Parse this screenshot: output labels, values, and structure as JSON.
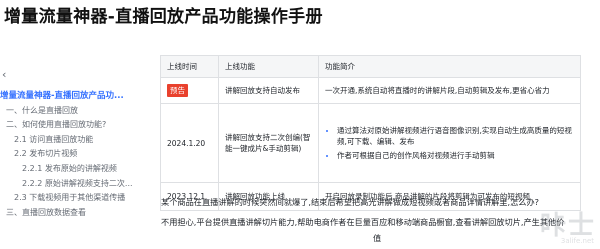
{
  "page": {
    "title": "增量流量神器-直播回放产品功能操作手册"
  },
  "sidebar": {
    "back_glyph": "‹",
    "items": [
      {
        "label": "增量流量神器-直播回放产品功..."
      },
      {
        "label": "一、什么是直播回放"
      },
      {
        "label": "二、如何使用直播回放功能?"
      },
      {
        "label": "2.1 访问直播回放功能"
      },
      {
        "label": "2.2 发布切片视频"
      },
      {
        "label": "2.2.1 发布原始的讲解视频"
      },
      {
        "label": "2.2.2 原始讲解视频支持二次..."
      },
      {
        "label": "2.3 下载视频用于其他渠道传播"
      },
      {
        "label": "三、直播回放数据查看"
      }
    ]
  },
  "table": {
    "headers": [
      "上线时间",
      "上线功能",
      "功能简介"
    ],
    "rows": [
      {
        "time": "预告",
        "feature": "讲解回放支持自动发布",
        "intro": "一次开通,系统自动将直播时的讲解片段,自动剪辑及发布,更省心省力"
      },
      {
        "time": "2024.1.20",
        "feature": "讲解回放支持二次创编(智能一键成片&手动剪辑)",
        "bullets": [
          "通过算法对原始讲解视频进行语音图像识别,实现自动生成高质量的短视频,可下载、编辑、发布",
          "作者可根据自己的创作风格对视频进行手动剪辑"
        ]
      },
      {
        "time": "2023.12.1",
        "feature": "讲解回放功能上线",
        "intro": "开启回放录制功能后,商品讲解的片段将剪辑为可发布的短视频"
      }
    ]
  },
  "body": {
    "p1": "某个商品在直播讲解的时候突然间就爆了,结束后希望把高光讲解做成短视频或者商品详情讲解里,怎么办?",
    "p2": "不用担心,平台提供直播讲解切片能力,帮助电商作者在巨量百应和移动端商品橱窗,查看讲解回放切片,产生其他价",
    "p3": "值"
  },
  "watermark": {
    "big": "咔士",
    "small": "3alife.net"
  },
  "colors": {
    "accent": "#3370ff",
    "badge": "#e9412d",
    "header_bg": "#f5f6f7",
    "border": "#dee0e3"
  }
}
